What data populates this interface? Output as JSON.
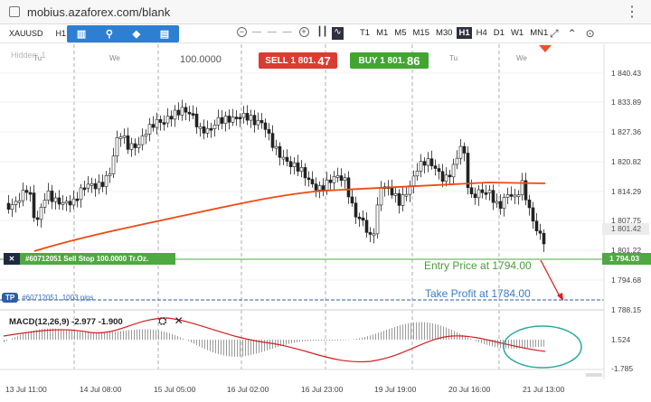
{
  "browser": {
    "url": "mobius.azaforex.com/blank",
    "menu_glyph": "⋮"
  },
  "toolbar": {
    "symbol": "XAUUSD",
    "timeframe": "H1",
    "zoom_in": "+",
    "zoom_out": "−",
    "timeframes": [
      "T1",
      "M1",
      "M5",
      "M15",
      "M30",
      "H1",
      "H4",
      "D1",
      "W1",
      "MN1"
    ],
    "active_timeframe": "H1"
  },
  "chart": {
    "hidden_label": "Hidden: 1",
    "day_labels": [
      "Tu",
      "We",
      "Tu",
      "We"
    ],
    "volume_value": "100.0000",
    "sell": {
      "prefix": "SELL 1 801.",
      "big": "47"
    },
    "buy": {
      "prefix": "BUY 1 801.",
      "big": "86"
    },
    "order_tag": "#60712051 Sell Stop 100.0000 Tr.Oz.",
    "tp_badge": "TP",
    "tp_text": "#60712051, 1003 pips",
    "entry_label": "Entry Price at 1794.00",
    "tp_label": "Take Profit at 1784.00",
    "current_price_tag": "1 801.42",
    "order_price_tag": "1 794.03",
    "y_labels": [
      "1 840.43",
      "1 833.89",
      "1 827.36",
      "1 820.82",
      "1 814.29",
      "1 807.75",
      "1 801.22",
      "1 794.68",
      "1 788.15"
    ],
    "macd_label": "MACD(12,26,9) -2.977 -1.900",
    "macd_y_labels": [
      "1.524",
      "-1.785"
    ],
    "x_labels": [
      "13 Jul 11:00",
      "14 Jul 08:00",
      "15 Jul 05:00",
      "16 Jul 02:00",
      "16 Jul 23:00",
      "19 Jul 19:00",
      "20 Jul 16:00",
      "21 Jul 13:00"
    ],
    "colors": {
      "sell": "#dd3b31",
      "buy": "#42a532",
      "ma": "#f04a12",
      "entry": "#4fa841",
      "tp": "#2f5ea8",
      "annotation": "#e0201c",
      "ellipse": "#2aa99c"
    }
  }
}
